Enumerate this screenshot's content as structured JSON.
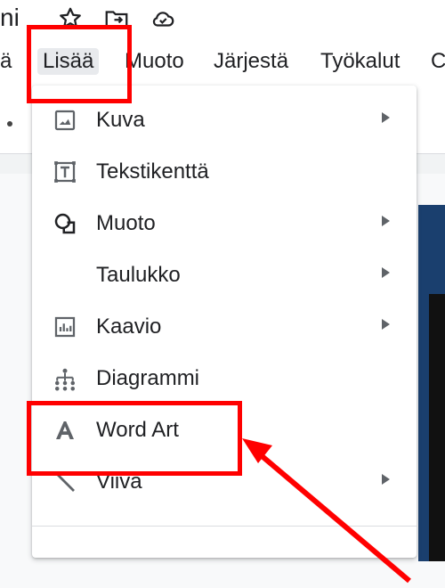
{
  "title_fragment": "ni",
  "top_icons": [
    "star-icon",
    "move-to-folder-icon",
    "cloud-status-icon"
  ],
  "menubar": {
    "items": [
      {
        "label": "ä"
      },
      {
        "label": "Lisää",
        "active": true
      },
      {
        "label": "Muoto"
      },
      {
        "label": "Järjestä"
      },
      {
        "label": "Työkalut"
      },
      {
        "label": "C"
      }
    ]
  },
  "insert_menu": {
    "items": [
      {
        "label": "Kuva",
        "icon": "image-icon",
        "submenu": true
      },
      {
        "label": "Tekstikenttä",
        "icon": "text-box-icon",
        "submenu": false
      },
      {
        "label": "Muoto",
        "icon": "shape-icon",
        "submenu": true
      },
      {
        "label": "Taulukko",
        "icon": "",
        "submenu": true
      },
      {
        "label": "Kaavio",
        "icon": "chart-icon",
        "submenu": true
      },
      {
        "label": "Diagrammi",
        "icon": "diagram-icon",
        "submenu": false
      },
      {
        "label": "Word Art",
        "icon": "word-art-icon",
        "submenu": false
      },
      {
        "label": "Viiva",
        "icon": "line-icon",
        "submenu": true
      }
    ]
  },
  "annotation_color": "#ff0000"
}
